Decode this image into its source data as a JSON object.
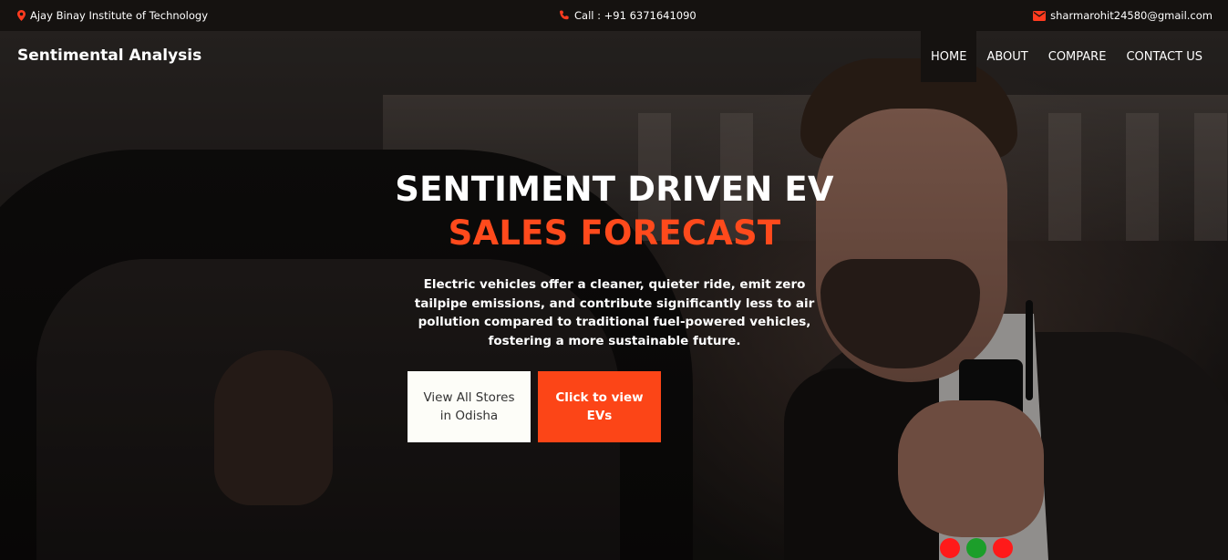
{
  "topbar": {
    "address": "Ajay Binay Institute of Technology",
    "phone": "Call : +91 6371641090",
    "email": "sharmarohit24580@gmail.com",
    "icons": {
      "address": "map-pin-icon",
      "phone": "phone-icon",
      "email": "mail-icon"
    }
  },
  "header": {
    "brand": "Sentimental Analysis",
    "nav": [
      {
        "label": "HOME",
        "active": true
      },
      {
        "label": "ABOUT",
        "active": false
      },
      {
        "label": "COMPARE",
        "active": false
      },
      {
        "label": "CONTACT US",
        "active": false
      }
    ]
  },
  "hero": {
    "title_line1": "SENTIMENT DRIVEN EV",
    "title_line2": "SALES FORECAST",
    "description": "Electric vehicles offer a cleaner, quieter ride, emit zero tailpipe emissions, and contribute significantly less to air pollution compared to traditional fuel-powered vehicles, fostering a more sustainable future.",
    "buttons": {
      "stores": "View All Stores in Odisha",
      "evs": "Click to view EVs"
    },
    "carousel_dots": [
      {
        "color": "#ff1a1a"
      },
      {
        "color": "#1c9e2a"
      },
      {
        "color": "#ff1a1a"
      }
    ]
  },
  "colors": {
    "accent": "#fc4517",
    "topbar_bg": "#151210",
    "icon": "#ff3b1f"
  }
}
